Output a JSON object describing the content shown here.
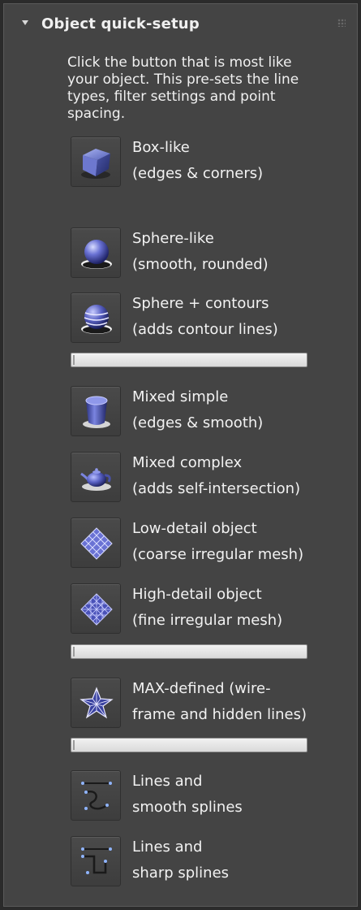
{
  "rollout": {
    "title": "Object quick-setup",
    "intro": "Click the button that is most like your object. This pre-sets the line types, filter settings and point spacing."
  },
  "presets": [
    {
      "line1": "Box-like",
      "line2": "(edges & corners)",
      "icon": "box-icon"
    },
    {
      "line1": "Sphere-like",
      "line2": "(smooth, rounded)",
      "icon": "sphere-icon"
    },
    {
      "line1": "Sphere + contours",
      "line2": "(adds contour lines)",
      "icon": "sphere-contours-icon"
    },
    {
      "line1": "Mixed simple",
      "line2": "(edges & smooth)",
      "icon": "cylinder-icon"
    },
    {
      "line1": "Mixed complex",
      "line2": "(adds self-intersection)",
      "icon": "teapot-icon"
    },
    {
      "line1": "Low-detail object",
      "line2": "(coarse irregular mesh)",
      "icon": "coarse-mesh-icon"
    },
    {
      "line1": "High-detail object",
      "line2": "(fine irregular mesh)",
      "icon": "fine-mesh-icon"
    },
    {
      "line1": "MAX-defined (wire-",
      "line2": "frame and hidden lines)",
      "icon": "wireframe-star-icon"
    },
    {
      "line1": "Lines and",
      "line2": "smooth splines",
      "icon": "smooth-spline-icon"
    },
    {
      "line1": "Lines and",
      "line2": "sharp splines",
      "icon": "sharp-spline-icon"
    }
  ]
}
